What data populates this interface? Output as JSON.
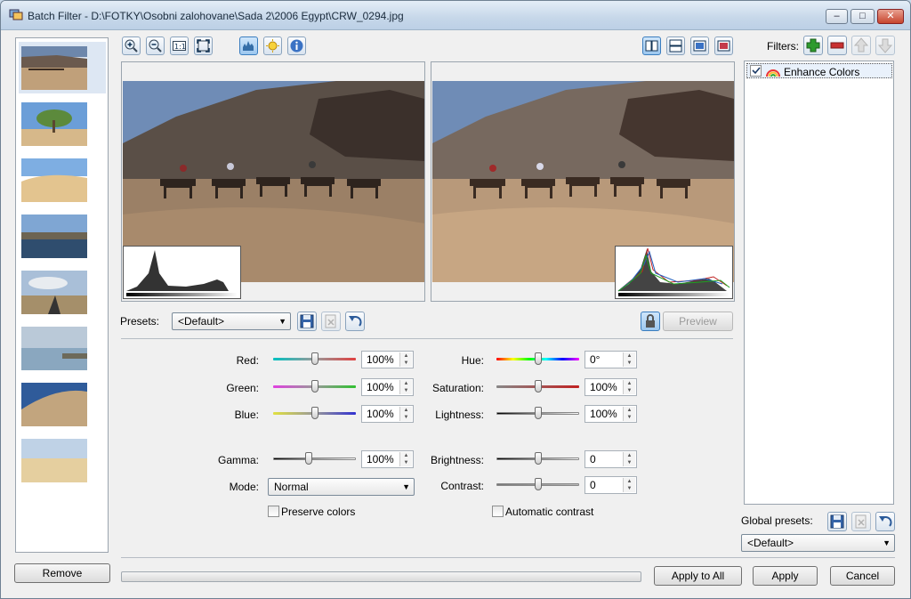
{
  "window": {
    "title": "Batch Filter - D:\\FOTKY\\Osobni zalohovane\\Sada 2\\2006 Egypt\\CRW_0294.jpg",
    "minimize_label": "–",
    "maximize_label": "□",
    "close_label": "✕"
  },
  "toolbar": {
    "icons": [
      "zoom-in-icon",
      "zoom-out-icon",
      "actual-size-icon",
      "fit-icon",
      "histogram-icon",
      "auto-icon",
      "info-icon"
    ],
    "view_icons": [
      "split-vertical-icon",
      "split-horizontal-icon",
      "original-only-icon",
      "processed-only-icon"
    ]
  },
  "presets": {
    "label": "Presets:",
    "value": "<Default>",
    "preview_label": "Preview"
  },
  "controls": {
    "red": {
      "label": "Red:",
      "value": "100%",
      "level": 0.5
    },
    "green": {
      "label": "Green:",
      "value": "100%",
      "level": 0.5
    },
    "blue": {
      "label": "Blue:",
      "value": "100%",
      "level": 0.5
    },
    "gamma": {
      "label": "Gamma:",
      "value": "100%",
      "level": 0.42
    },
    "mode": {
      "label": "Mode:",
      "value": "Normal"
    },
    "preserve_colors": {
      "label": "Preserve colors",
      "checked": false
    },
    "hue": {
      "label": "Hue:",
      "value": "0°",
      "level": 0.5
    },
    "saturation": {
      "label": "Saturation:",
      "value": "100%",
      "level": 0.5
    },
    "lightness": {
      "label": "Lightness:",
      "value": "100%",
      "level": 0.5
    },
    "brightness": {
      "label": "Brightness:",
      "value": "0",
      "level": 0.5
    },
    "contrast": {
      "label": "Contrast:",
      "value": "0",
      "level": 0.5
    },
    "automatic_contrast": {
      "label": "Automatic contrast",
      "checked": false
    }
  },
  "filters": {
    "label": "Filters:",
    "items": [
      {
        "label": "Enhance Colors",
        "checked": true
      }
    ]
  },
  "global_presets": {
    "label": "Global presets:",
    "value": "<Default>"
  },
  "buttons": {
    "remove": "Remove",
    "apply_to_all": "Apply to All",
    "apply": "Apply",
    "cancel": "Cancel"
  },
  "thumbnails": [
    "camels-desert",
    "tree-sand",
    "dunes",
    "river-nile",
    "road-clouds",
    "lake-shore",
    "temple-rocks",
    "flat-desert"
  ],
  "colors": {
    "accent": "#3a7dbf",
    "titlebar": "#c6d7e9"
  }
}
